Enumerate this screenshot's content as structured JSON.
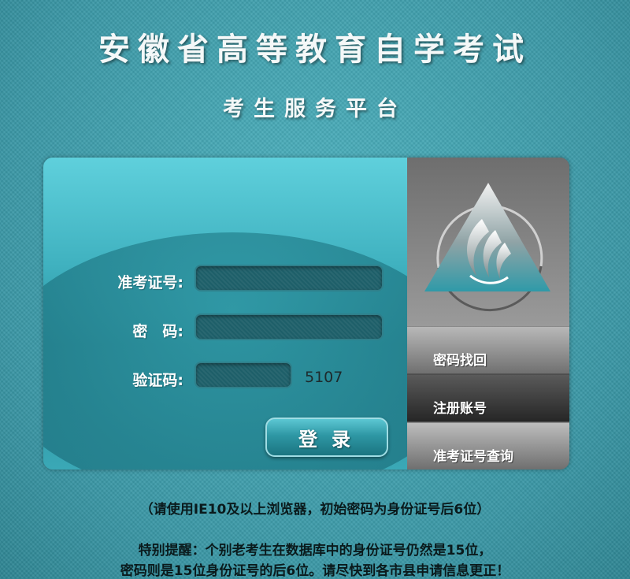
{
  "header": {
    "title": "安徽省高等教育自学考试",
    "subtitle": "考生服务平台"
  },
  "login": {
    "exam_id_label": "准考证号:",
    "password_label": "密　码:",
    "captcha_label": "验证码:",
    "exam_id_value": "",
    "password_value": "",
    "captcha_value": "",
    "captcha_code": "5107",
    "login_button": "登录"
  },
  "sidebar": {
    "items": [
      {
        "label": "密码找回"
      },
      {
        "label": "注册账号"
      },
      {
        "label": "准考证号查询"
      }
    ]
  },
  "notices": {
    "browser_hint": "（请使用IE10及以上浏览器，初始密码为身份证号后6位）",
    "special_line1": "特别提醒：个别老考生在数据库中的身份证号仍然是15位，",
    "special_line2": "密码则是15位身份证号的后6位。请尽快到各市县申请信息更正！"
  },
  "colors": {
    "background": "#3f9fad",
    "panel_accent": "#3fb1bf",
    "sidebar_gray": "#707070"
  },
  "icons": {
    "logo": "triangle-flame-emblem-icon"
  }
}
